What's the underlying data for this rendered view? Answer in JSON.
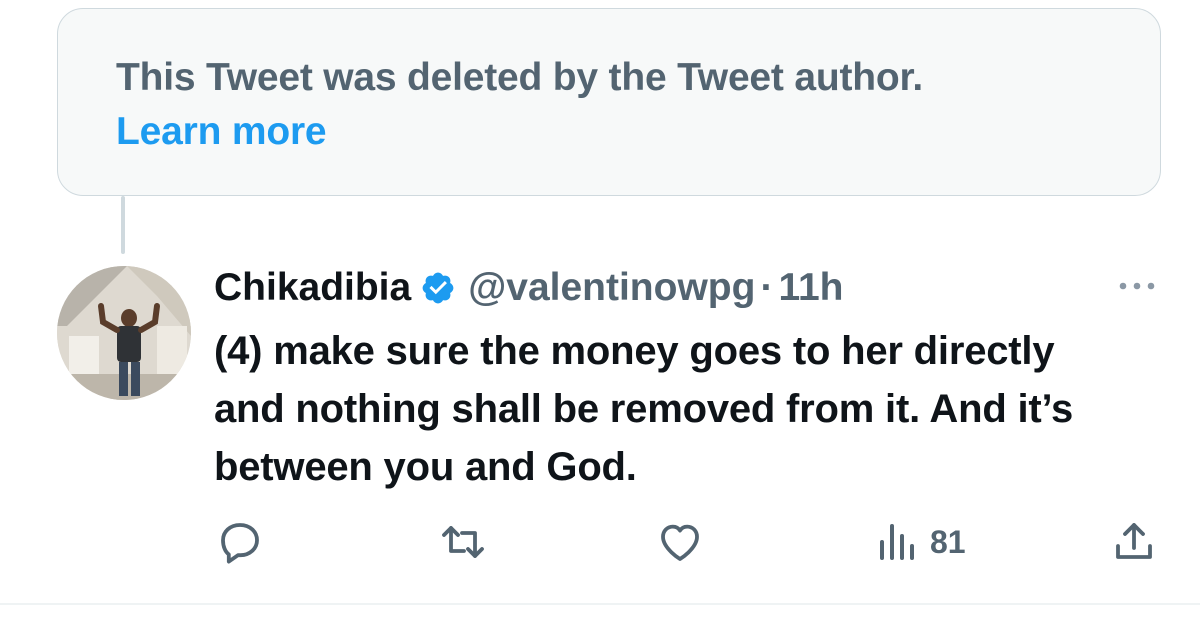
{
  "deleted_notice": {
    "message": "This Tweet was deleted by the Tweet author.",
    "learn_more_label": "Learn more"
  },
  "tweet": {
    "display_name": "Chikadibia",
    "verified": true,
    "handle": "@valentinowpg",
    "separator": "·",
    "timestamp": "11h",
    "text": "(4) make sure the money goes to her directly and nothing shall be removed from it. And it’s between you and God.",
    "views": "81"
  },
  "colors": {
    "primary_text": "#0f1419",
    "secondary_text": "#536471",
    "accent": "#1d9bf0",
    "card_background": "#f7f9f9",
    "border": "#cfd9de"
  },
  "icons": {
    "more": "more-horizontal-icon",
    "verified": "verified-badge-icon",
    "reply": "reply-icon",
    "retweet": "retweet-icon",
    "like": "heart-icon",
    "views": "views-chart-icon",
    "share": "share-icon"
  }
}
